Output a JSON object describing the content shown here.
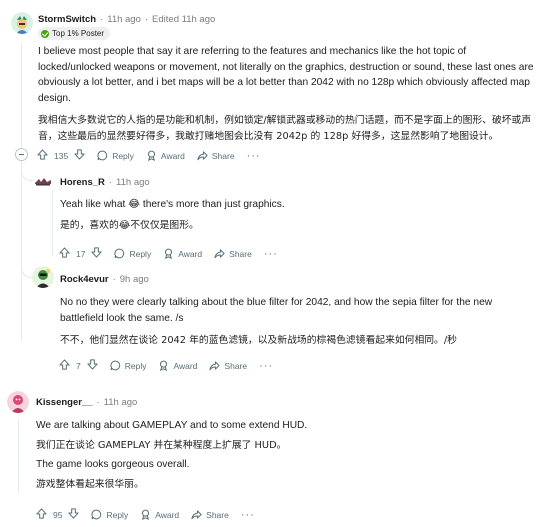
{
  "comments": [
    {
      "user": "StormSwitch",
      "time": "11h ago",
      "edited": "Edited 11h ago",
      "flair": "Top 1% Poster",
      "paragraphs": [
        "I believe most people that say it are referring to the features and mechanics like the hot topic of locked/unlocked weapons or movement, not literally on the graphics, destruction or sound, these last ones are obviously a lot better, and i bet maps will be a lot better than 2042 with no 128p which obviously affected map design.",
        "我相信大多数说它的人指的是功能和机制，例如锁定/解锁武器或移动的热门话题，而不是字面上的图形、破坏或声音，这些最后的显然要好得多，我敢打赌地图会比没有 2042p 的 128p 好得多，这显然影响了地图设计。"
      ],
      "votes": "135",
      "reply": "Reply",
      "award": "Award",
      "share": "Share",
      "more": "···"
    },
    {
      "user": "Horens_R",
      "time": "11h ago",
      "paragraphs": [
        "Yeah like what 😂 there's more than just graphics.",
        "是的，喜欢的😂不仅仅是图形。"
      ],
      "votes": "17",
      "reply": "Reply",
      "award": "Award",
      "share": "Share",
      "more": "···"
    },
    {
      "user": "Rock4evur",
      "time": "9h ago",
      "paragraphs": [
        "No no they were clearly talking about the blue filter for 2042, and how the sepia filter for the new battlefield look the same. /s",
        "不不，他们显然在谈论 2042 年的蓝色滤镜，以及新战场的棕褐色滤镜看起来如何相同。/秒"
      ],
      "votes": "7",
      "reply": "Reply",
      "award": "Award",
      "share": "Share",
      "more": "···"
    },
    {
      "user": "Kissenger__",
      "time": "11h ago",
      "paragraphs": [
        "We are talking about GAMEPLAY and to some extend HUD.",
        "我们正在谈论 GAMEPLAY 并在某种程度上扩展了 HUD。",
        "The game looks gorgeous overall.",
        "游戏整体看起来很华丽。"
      ],
      "votes": "95",
      "reply": "Reply",
      "award": "Award",
      "share": "Share",
      "more": "···"
    }
  ],
  "colors": {
    "meta": "#7c7c7c",
    "action": "#576f76",
    "thread": "#e5ebee",
    "flair_bg": "#edeff1",
    "flair_icon": "#46a508"
  },
  "icons": [
    "upvote-icon",
    "downvote-icon",
    "comment-icon",
    "award-icon",
    "share-icon",
    "collapse-icon",
    "more-icon"
  ]
}
